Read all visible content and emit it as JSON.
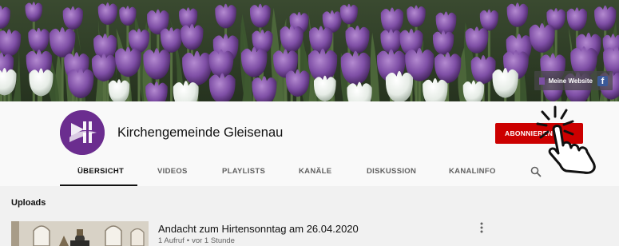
{
  "banner": {
    "website_link_label": "Meine Website",
    "facebook_label": "f"
  },
  "channel": {
    "name": "Kirchengemeinde Gleisenau",
    "subscribe_label": "ABONNIEREN"
  },
  "tabs": [
    {
      "label": "ÜBERSICHT",
      "active": true
    },
    {
      "label": "VIDEOS"
    },
    {
      "label": "PLAYLISTS"
    },
    {
      "label": "KANÄLE"
    },
    {
      "label": "DISKUSSION"
    },
    {
      "label": "KANALINFO"
    }
  ],
  "section": {
    "title": "Uploads"
  },
  "video": {
    "title": "Andacht zum Hirtensonntag am 26.04.2020",
    "views": "1 Aufruf",
    "separator": "•",
    "age": "vor 1 Stunde"
  },
  "colors": {
    "subscribe": "#cc0000",
    "avatar": "#6b2d8f",
    "header_bg": "#f9f9f9",
    "page_bg": "#f1f1f1"
  }
}
